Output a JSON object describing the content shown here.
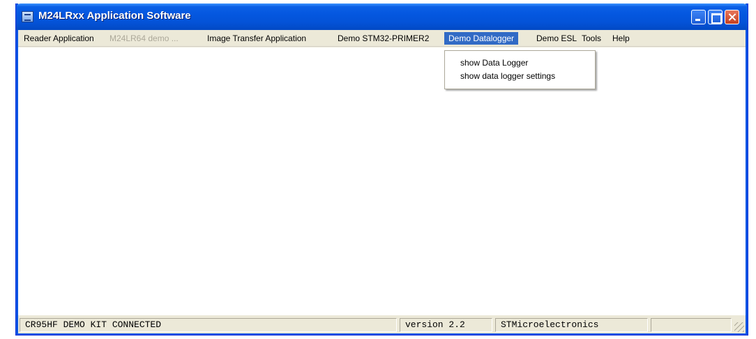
{
  "window": {
    "title": "M24LRxx Application Software",
    "app_icon": "app-icon"
  },
  "menubar": {
    "items": [
      {
        "label": "Reader Application",
        "state": "normal"
      },
      {
        "label": "M24LR64 demo ...",
        "state": "disabled"
      },
      {
        "label": "Image Transfer Application",
        "state": "normal"
      },
      {
        "label": "Demo STM32-PRIMER2",
        "state": "normal"
      },
      {
        "label": "Demo Datalogger",
        "state": "open"
      },
      {
        "label": "Demo ESL",
        "state": "normal"
      },
      {
        "label": "Tools",
        "state": "normal"
      },
      {
        "label": "Help",
        "state": "normal"
      }
    ]
  },
  "dropdown": {
    "items": [
      {
        "label": "show Data Logger"
      },
      {
        "label": "show data logger settings"
      }
    ]
  },
  "statusbar": {
    "panels": [
      {
        "text": "CR95HF DEMO KIT CONNECTED"
      },
      {
        "text": "version 2.2"
      },
      {
        "text": "STMicroelectronics"
      },
      {
        "text": ""
      }
    ]
  },
  "colors": {
    "titlebar": "#0453d8",
    "menu_highlight": "#316ac5",
    "disabled_text": "#aca899",
    "chrome": "#ece9d8"
  }
}
